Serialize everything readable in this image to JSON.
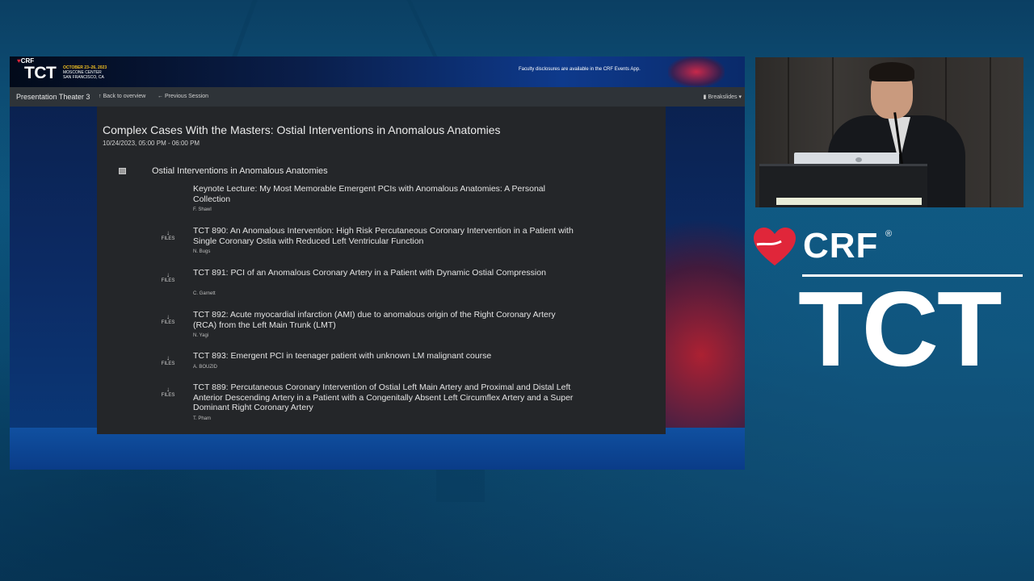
{
  "header": {
    "crf_label": "CRF",
    "tct_label": "TCT",
    "event_date": "OCTOBER 23–26, 2023",
    "event_venue": "MOSCONE CENTER",
    "event_city": "SAN FRANCISCO, CA",
    "disclosure": "Faculty disclosures are available in the CRF Events App."
  },
  "nav": {
    "room": "Presentation Theater 3",
    "back": "Back to overview",
    "previous": "Previous Session",
    "breakslides": "Breakslides"
  },
  "session": {
    "title": "Complex Cases With the Masters: Ostial Interventions in Anomalous Anatomies",
    "time": "10/24/2023, 05:00 PM - 06:00 PM",
    "group_title": "Ostial Interventions in Anomalous Anatomies"
  },
  "talks": [
    {
      "files": "",
      "title": "Keynote Lecture: My Most Memorable Emergent PCIs with Anomalous Anatomies: A Personal Collection",
      "author": "F. Shawl"
    },
    {
      "files": "FILES",
      "title": "TCT 890: An Anomalous Intervention: High Risk Percutaneous Coronary Intervention in a Patient with Single Coronary Ostia with Reduced Left Ventricular Function",
      "author": "N. Bugs"
    },
    {
      "files": "FILES",
      "title": "TCT 891: PCI of an Anomalous Coronary Artery in a Patient with Dynamic Ostial Compression",
      "author": "C. Garnett"
    },
    {
      "files": "FILES",
      "title": "TCT 892: Acute myocardial infarction (AMI) due to anomalous origin of the Right Coronary Artery (RCA) from the Left Main Trunk (LMT)",
      "author": "N. Yagi"
    },
    {
      "files": "FILES",
      "title": "TCT 893: Emergent PCI in teenager patient with unknown LM malignant course",
      "author": "A. BOUZID"
    },
    {
      "files": "FILES",
      "title": "TCT 889: Percutaneous Coronary Intervention of Ostial Left Main Artery and Proximal and Distal Left Anterior Descending Artery in a Patient with a Congenitally Absent Left Circumflex Artery and a Super Dominant Right Coronary Artery",
      "author": "T. Pham"
    }
  ],
  "branding": {
    "crf": "CRF",
    "registered": "®",
    "tct": "TCT"
  },
  "colors": {
    "crf_red": "#e0263a",
    "event_yellow": "#f4c020",
    "panel_bg": "#242629",
    "navbar_bg": "#2e3338"
  },
  "icons": {
    "files": "download-arrow-icon",
    "group": "list-square-icon",
    "back": "arrow-up-icon",
    "previous": "arrow-left-icon",
    "breakslides": "columns-icon"
  }
}
